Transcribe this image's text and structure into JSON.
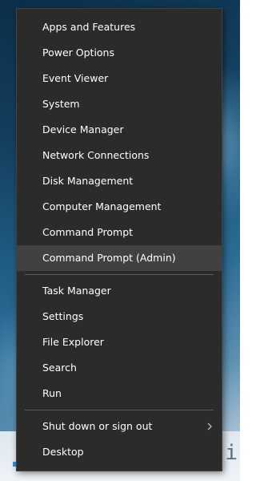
{
  "menu": {
    "group1": [
      {
        "id": "apps-and-features",
        "label": "Apps and Features"
      },
      {
        "id": "power-options",
        "label": "Power Options"
      },
      {
        "id": "event-viewer",
        "label": "Event Viewer"
      },
      {
        "id": "system",
        "label": "System"
      },
      {
        "id": "device-manager",
        "label": "Device Manager"
      },
      {
        "id": "network-connections",
        "label": "Network Connections"
      },
      {
        "id": "disk-management",
        "label": "Disk Management"
      },
      {
        "id": "computer-management",
        "label": "Computer Management"
      },
      {
        "id": "command-prompt",
        "label": "Command Prompt"
      },
      {
        "id": "command-prompt-admin",
        "label": "Command Prompt (Admin)",
        "highlighted": true
      }
    ],
    "group2": [
      {
        "id": "task-manager",
        "label": "Task Manager"
      },
      {
        "id": "settings",
        "label": "Settings"
      },
      {
        "id": "file-explorer",
        "label": "File Explorer"
      },
      {
        "id": "search",
        "label": "Search"
      },
      {
        "id": "run",
        "label": "Run"
      }
    ],
    "group3": [
      {
        "id": "shut-down-or-sign-out",
        "label": "Shut down or sign out",
        "submenu_icon": "chevron-right-icon"
      },
      {
        "id": "desktop",
        "label": "Desktop"
      }
    ]
  },
  "colors": {
    "menu_background": "#2b2b2b",
    "menu_highlight": "#414141",
    "menu_text": "#ffffff",
    "separator": "#5a5a5a"
  },
  "background_text": "adi"
}
